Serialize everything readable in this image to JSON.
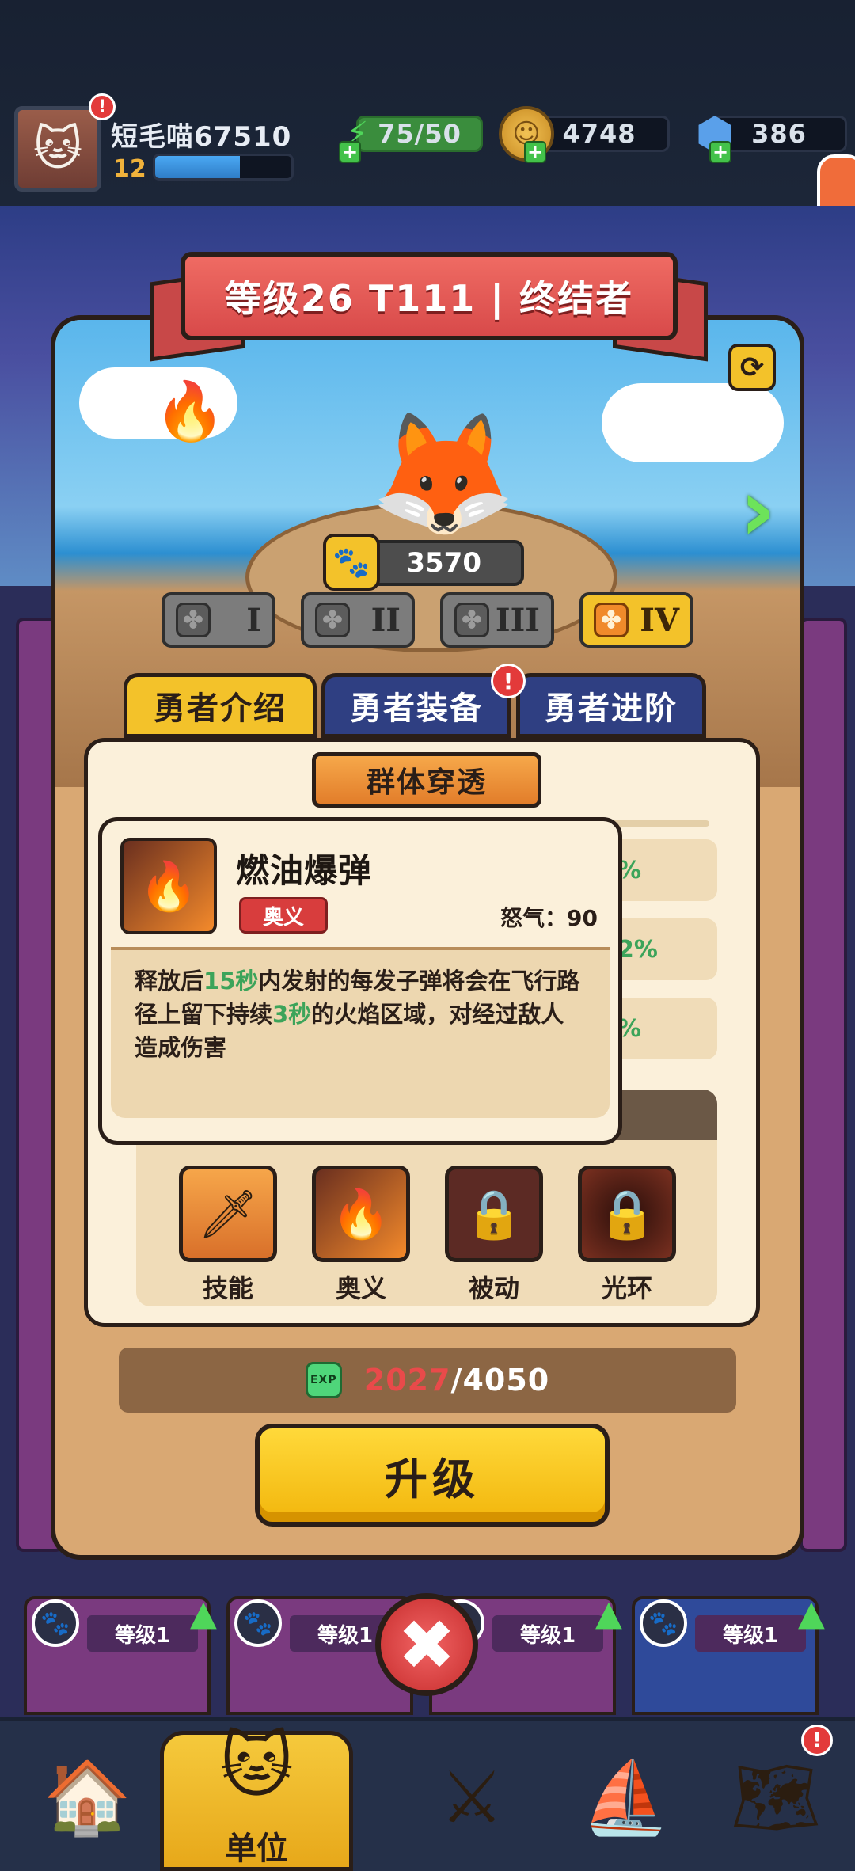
{
  "player": {
    "name": "短毛喵67510",
    "level": "12",
    "xp_progress": 0.62,
    "badge": "!"
  },
  "resources": {
    "energy": "75/50",
    "gold": "4748",
    "gems": "386"
  },
  "hero": {
    "title": "等级26 T111 | 终结者",
    "power": "3570",
    "tiers": [
      "I",
      "II",
      "III",
      "IV"
    ],
    "active_tier": "IV"
  },
  "tabs": {
    "intro": "勇者介绍",
    "equipment": "勇者装备",
    "advance": "勇者进阶",
    "equipment_badge": "!"
  },
  "info": {
    "subtitle": "群体穿透",
    "stat_fragments": [
      "%",
      "2%",
      "%"
    ]
  },
  "tooltip": {
    "skill_name": "燃油爆弹",
    "tag": "奥义",
    "rage_label": "怒气：",
    "rage_value": "90",
    "desc_1": "释放后",
    "desc_hl_1": "15秒",
    "desc_2": "内发射的每发子弹将会在飞行路径上留下持续",
    "desc_hl_2": "3秒",
    "desc_3": "的火焰区域，对经过敌人造成伤害"
  },
  "skills": [
    {
      "label": "技能",
      "icon": "spear-tip-icon"
    },
    {
      "label": "奥义",
      "icon": "flame-breath-icon"
    },
    {
      "label": "被动",
      "icon": "lock-icon"
    },
    {
      "label": "光环",
      "icon": "lock-icon"
    }
  ],
  "exp": {
    "current": "2027",
    "separator": "/",
    "total": "4050",
    "icon_text": "EXP"
  },
  "upgrade_label": "升级",
  "hero_cards": [
    {
      "level": "等级1"
    },
    {
      "level": "等级1"
    },
    {
      "level": "等级1"
    },
    {
      "level": "等级1"
    }
  ],
  "nav": {
    "active_label": "单位",
    "badge": "!"
  },
  "colors": {
    "accent_yellow": "#f3c22a",
    "banner_red": "#d84a4a",
    "highlight_green": "#3ca45a",
    "exp_red": "#e94a4a"
  }
}
